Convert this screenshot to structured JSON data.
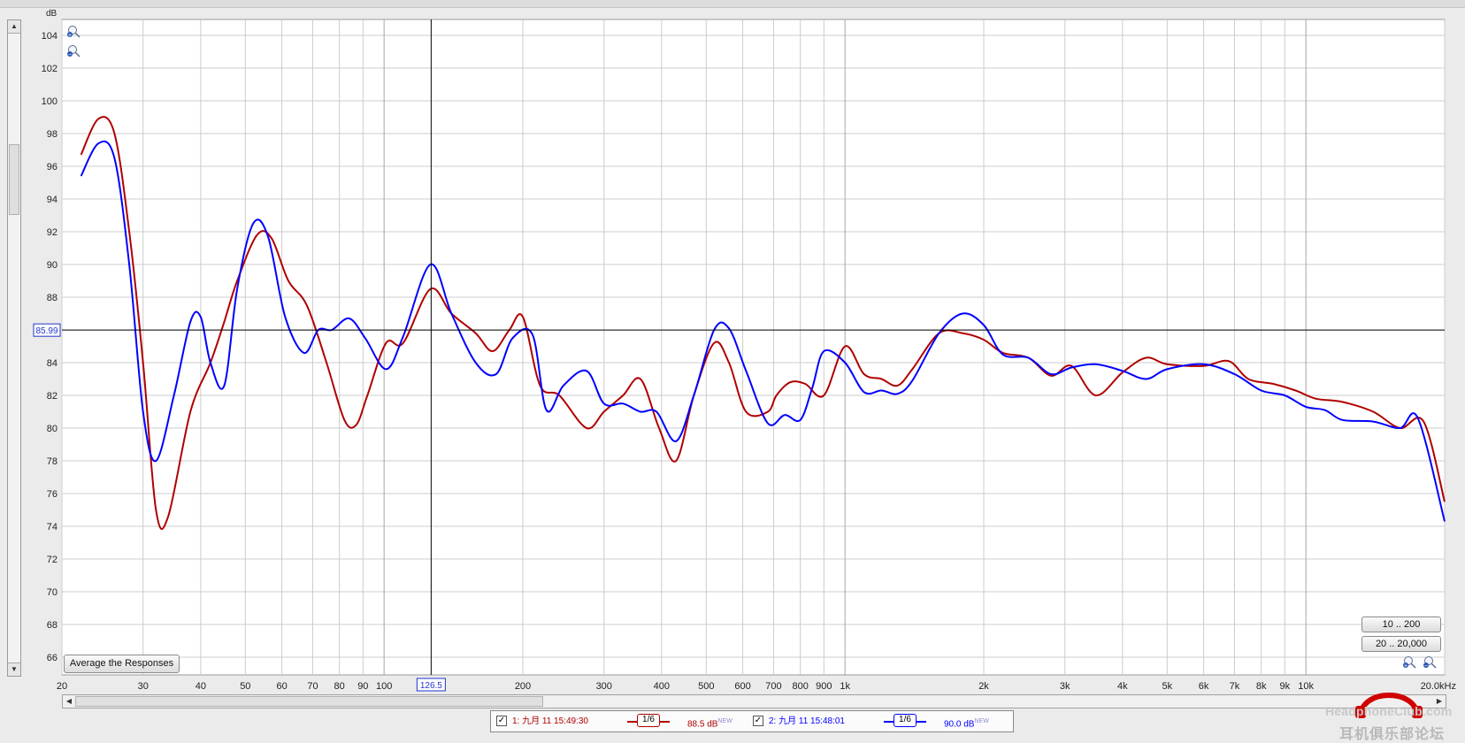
{
  "y_axis": {
    "unit": "dB",
    "ticks": [
      "104",
      "102",
      "100",
      "98",
      "96",
      "94",
      "92",
      "90",
      "88",
      "86",
      "84",
      "82",
      "80",
      "78",
      "76",
      "74",
      "72",
      "70",
      "68",
      "66"
    ]
  },
  "x_axis": {
    "unit": "kHz",
    "ticks": [
      {
        "f": 20,
        "label": "20"
      },
      {
        "f": 30,
        "label": "30"
      },
      {
        "f": 40,
        "label": "40"
      },
      {
        "f": 50,
        "label": "50"
      },
      {
        "f": 60,
        "label": "60"
      },
      {
        "f": 70,
        "label": "70"
      },
      {
        "f": 80,
        "label": "80"
      },
      {
        "f": 90,
        "label": "90"
      },
      {
        "f": 100,
        "label": "100"
      },
      {
        "f": 200,
        "label": "200"
      },
      {
        "f": 300,
        "label": "300"
      },
      {
        "f": 400,
        "label": "400"
      },
      {
        "f": 500,
        "label": "500"
      },
      {
        "f": 600,
        "label": "600"
      },
      {
        "f": 700,
        "label": "700"
      },
      {
        "f": 800,
        "label": "800"
      },
      {
        "f": 900,
        "label": "900"
      },
      {
        "f": 1000,
        "label": "1k"
      },
      {
        "f": 2000,
        "label": "2k"
      },
      {
        "f": 3000,
        "label": "3k"
      },
      {
        "f": 4000,
        "label": "4k"
      },
      {
        "f": 5000,
        "label": "5k"
      },
      {
        "f": 6000,
        "label": "6k"
      },
      {
        "f": 7000,
        "label": "7k"
      },
      {
        "f": 8000,
        "label": "8k"
      },
      {
        "f": 9000,
        "label": "9k"
      },
      {
        "f": 10000,
        "label": "10k"
      },
      {
        "f": 20000,
        "label": "20.0kHz"
      }
    ]
  },
  "cursor": {
    "freq_label": "126.5",
    "freq": 126.5,
    "level_label": "85.99",
    "level": 85.99
  },
  "buttons": {
    "average": "Average the Responses",
    "range_10_200": "10 .. 200",
    "range_20_20000": "20 .. 20,000"
  },
  "legend": {
    "m1": {
      "checked": "✓",
      "label": "1: 九月 11 15:49:30",
      "smoothing": "1/6",
      "level": "88.5 dB",
      "new": "NEW"
    },
    "m2": {
      "checked": "✓",
      "label": "2: 九月 11 15:48:01",
      "smoothing": "1/6",
      "level": "90.0 dB",
      "new": "NEW"
    }
  },
  "watermark": {
    "brand": "HeadphoneClub.com",
    "chinese": "耳机俱乐部论坛"
  },
  "colors": {
    "measurement_1": "#b00000",
    "measurement_2": "#0000ff",
    "cursor": "#000000",
    "grid": "#cccccc",
    "plot_bg": "#ffffff"
  },
  "icons": {
    "zoom_in": "zoom-in-icon",
    "zoom_out": "zoom-out-icon"
  },
  "chart_data": {
    "type": "line",
    "xlabel": "kHz",
    "ylabel": "dB",
    "x_scale": "log",
    "xlim": [
      20,
      20000
    ],
    "ylim": [
      65,
      105
    ],
    "grid": true,
    "series": [
      {
        "name": "1: 九月 11 15:49:30",
        "color": "#b00000",
        "x": [
          22,
          24,
          26,
          28,
          30,
          32,
          34,
          38,
          42,
          45,
          48,
          53,
          57,
          62,
          68,
          75,
          82,
          87,
          92,
          101,
          110,
          126,
          140,
          158,
          172,
          187,
          200,
          218,
          240,
          275,
          300,
          330,
          360,
          395,
          430,
          470,
          520,
          560,
          610,
          680,
          710,
          760,
          820,
          900,
          1000,
          1100,
          1200,
          1300,
          1400,
          1600,
          1800,
          2000,
          2200,
          2500,
          2800,
          3100,
          3500,
          4000,
          4500,
          5000,
          6000,
          6800,
          7500,
          8500,
          9500,
          10500,
          12000,
          14000,
          16000,
          18000,
          20000
        ],
        "values": [
          96.7,
          98.9,
          98.0,
          92.0,
          84.0,
          75.0,
          74.6,
          81.0,
          84.0,
          86.5,
          89.0,
          91.8,
          91.6,
          89.0,
          87.5,
          84.0,
          80.5,
          80.2,
          82.0,
          85.2,
          85.2,
          88.5,
          87.0,
          85.8,
          84.7,
          86.0,
          86.8,
          82.6,
          82.0,
          80.0,
          81.0,
          82.0,
          83.0,
          80.0,
          78.0,
          82.0,
          85.2,
          84.0,
          81.0,
          81.0,
          82.0,
          82.8,
          82.7,
          82.0,
          85.0,
          83.3,
          83.0,
          82.6,
          83.6,
          85.8,
          85.8,
          85.4,
          84.6,
          84.3,
          83.2,
          83.8,
          82.0,
          83.4,
          84.3,
          83.9,
          83.8,
          84.1,
          83.0,
          82.7,
          82.3,
          81.8,
          81.6,
          81.0,
          80.0,
          80.4,
          75.5
        ]
      },
      {
        "name": "2: 九月 11 15:48:01",
        "color": "#0000ff",
        "x": [
          22,
          24,
          26,
          28,
          30,
          32,
          35,
          38,
          40,
          42,
          45,
          48,
          52,
          56,
          61,
          67,
          72,
          77,
          84,
          91,
          101,
          110,
          126,
          140,
          158,
          175,
          190,
          210,
          225,
          245,
          275,
          300,
          330,
          360,
          390,
          430,
          470,
          520,
          560,
          610,
          680,
          740,
          800,
          850,
          900,
          1000,
          1100,
          1200,
          1300,
          1400,
          1600,
          1800,
          2000,
          2200,
          2500,
          2800,
          3100,
          3500,
          4000,
          4500,
          5000,
          6000,
          7000,
          8000,
          9000,
          10000,
          11000,
          12000,
          14000,
          16000,
          17500,
          20000
        ],
        "values": [
          95.4,
          97.4,
          96.5,
          90.0,
          81.0,
          78.0,
          82.0,
          86.5,
          86.8,
          84.0,
          82.6,
          88.5,
          92.5,
          91.7,
          86.8,
          84.6,
          86.0,
          86.0,
          86.7,
          85.5,
          83.6,
          85.6,
          90.0,
          87.0,
          84.0,
          83.3,
          85.5,
          85.7,
          81.1,
          82.6,
          83.5,
          81.5,
          81.5,
          81.0,
          81.0,
          79.2,
          82.0,
          86.0,
          86.1,
          83.5,
          80.3,
          80.8,
          80.5,
          82.5,
          84.7,
          84.0,
          82.2,
          82.3,
          82.1,
          82.9,
          85.8,
          87.0,
          86.3,
          84.5,
          84.3,
          83.3,
          83.7,
          83.9,
          83.5,
          83.0,
          83.6,
          83.9,
          83.3,
          82.3,
          82.0,
          81.3,
          81.1,
          80.5,
          80.4,
          80.0,
          80.6,
          74.3
        ]
      }
    ]
  }
}
